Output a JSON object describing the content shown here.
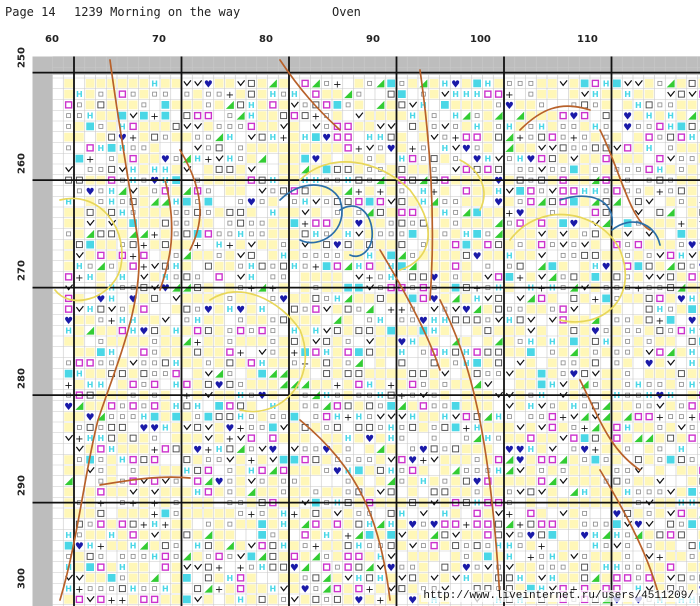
{
  "header": {
    "page_label": "Page 14",
    "pattern_title": "1239 Morning on the way",
    "subtitle": "Oven"
  },
  "grid": {
    "col_labels": [
      "60",
      "70",
      "80",
      "90",
      "100",
      "110"
    ],
    "row_labels": [
      "250",
      "260",
      "270",
      "280",
      "290",
      "300"
    ],
    "col_start": 58,
    "col_end": 119,
    "row_start": 249,
    "row_end": 300
  },
  "colors": {
    "background": "#ffffff",
    "grid_minor": "#c9c9c9",
    "grid_major": "#111111",
    "pale_yellow": "#fff7b8",
    "outline_brown": "#b8612a",
    "outline_yellow": "#e8d75a",
    "outline_blue": "#2b6fa8",
    "cyan": "#4ad7e6",
    "magenta": "#cc33cc",
    "green": "#33cc33",
    "navy": "#1a1aa8",
    "grey": "#8a8a8a"
  },
  "watermark": "http://www.liveinternet.ru/users/4511209/"
}
